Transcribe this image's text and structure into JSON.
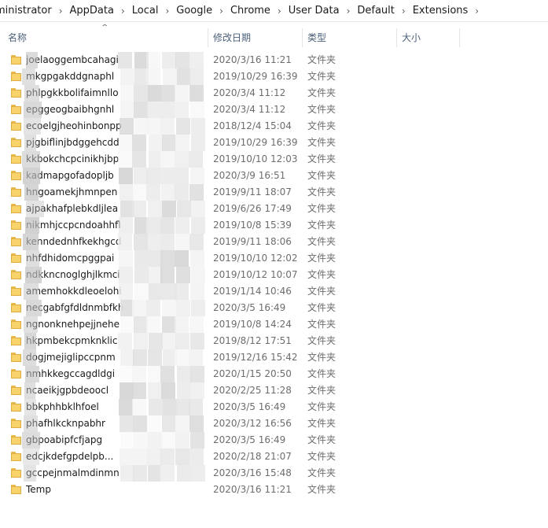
{
  "breadcrumb": [
    "ministrator",
    "AppData",
    "Local",
    "Google",
    "Chrome",
    "User Data",
    "Default",
    "Extensions"
  ],
  "columns": {
    "name": "名称",
    "modified": "修改日期",
    "type": "类型",
    "size": "大小"
  },
  "rows": [
    {
      "name": "joelaoggembcahagi",
      "date": "2020/3/16 11:21",
      "type": "文件夹"
    },
    {
      "name": "mkgpgakddgnaphl",
      "date": "2019/10/29 16:39",
      "type": "文件夹"
    },
    {
      "name": "phlpgkkbolifaimnllo",
      "date": "2020/3/4 11:12",
      "type": "文件夹"
    },
    {
      "name": "epggeogbaibhgnhl",
      "date": "2020/3/4 11:12",
      "type": "文件夹"
    },
    {
      "name": "ecoelgjheohinbonpp",
      "date": "2018/12/4 15:04",
      "type": "文件夹"
    },
    {
      "name": "pjgbiflinjbdggehcdd",
      "date": "2019/10/29 16:39",
      "type": "文件夹"
    },
    {
      "name": "kkbokchcpcinikhjbp",
      "date": "2019/10/10 12:03",
      "type": "文件夹"
    },
    {
      "name": "kadmapgofadopljb",
      "date": "2020/3/9 16:51",
      "type": "文件夹"
    },
    {
      "name": "hngoamekjhmnpen",
      "date": "2019/9/11 18:07",
      "type": "文件夹"
    },
    {
      "name": "ajpakhafplebkdljlea",
      "date": "2019/6/26 17:49",
      "type": "文件夹"
    },
    {
      "name": "nikmhjccpcndoahhfl",
      "date": "2019/10/8 15:39",
      "type": "文件夹"
    },
    {
      "name": "kenndednhfkekhgcd",
      "date": "2019/9/11 18:06",
      "type": "文件夹"
    },
    {
      "name": "nhfdhidomcpggpai",
      "date": "2019/10/10 12:02",
      "type": "文件夹"
    },
    {
      "name": "ndkkncnoglghjlkmci",
      "date": "2019/10/12 10:07",
      "type": "文件夹"
    },
    {
      "name": "amemhokkdleoelohi",
      "date": "2019/1/14 10:46",
      "type": "文件夹"
    },
    {
      "name": "necgabfgfdldnmbfkh",
      "date": "2020/3/5 16:49",
      "type": "文件夹"
    },
    {
      "name": "ngnonknehpejjnehe",
      "date": "2019/10/8 14:24",
      "type": "文件夹"
    },
    {
      "name": "hkpmbekcpmknklic",
      "date": "2019/8/12 17:51",
      "type": "文件夹"
    },
    {
      "name": "dogjmejiglipccpnm",
      "date": "2019/12/16 15:42",
      "type": "文件夹"
    },
    {
      "name": "nmhkkegccagdldgi",
      "date": "2020/1/15 20:50",
      "type": "文件夹"
    },
    {
      "name": "ncaeikjgpbdeoocl",
      "date": "2020/2/25 11:28",
      "type": "文件夹"
    },
    {
      "name": "bbkphhbklhfoel",
      "date": "2020/3/5 16:49",
      "type": "文件夹"
    },
    {
      "name": "phafhlkcknpabhr",
      "date": "2020/3/12 16:56",
      "type": "文件夹"
    },
    {
      "name": "gbpoabipfcfjapg",
      "date": "2020/3/5 16:49",
      "type": "文件夹"
    },
    {
      "name": "edcjkdefgpdelpb...",
      "date": "2020/2/18 21:07",
      "type": "文件夹"
    },
    {
      "name": "gccpejnmalmdinmn",
      "date": "2020/3/16 15:48",
      "type": "文件夹"
    },
    {
      "name": "Temp",
      "date": "2020/3/16 11:21",
      "type": "文件夹"
    }
  ],
  "colors": {
    "header_text": "#4c607a",
    "folder_fill": "#f8d26a",
    "folder_edge": "#dfae42"
  }
}
